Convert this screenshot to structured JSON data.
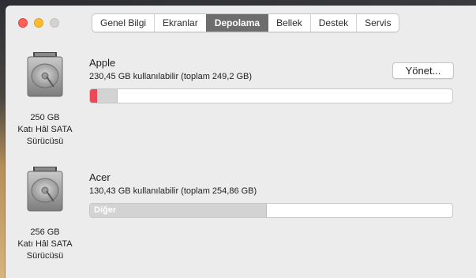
{
  "window": {
    "tabs": [
      {
        "label": "Genel Bilgi",
        "active": false
      },
      {
        "label": "Ekranlar",
        "active": false
      },
      {
        "label": "Depolama",
        "active": true
      },
      {
        "label": "Bellek",
        "active": false
      },
      {
        "label": "Destek",
        "active": false
      },
      {
        "label": "Servis",
        "active": false
      }
    ]
  },
  "colors": {
    "used_segment": "#ec4957",
    "other_segment": "#d3d3d3",
    "active_tab": "#6d6d6d"
  },
  "disks": [
    {
      "name": "Apple",
      "available": "230,45 GB kullanılabilir (toplam 249,2 GB)",
      "caption_size": "250 GB",
      "caption_type": "Katı Hâl SATA",
      "caption_kind": "Sürücüsü",
      "manage_label": "Yönet...",
      "icon": "hard-drive-icon",
      "usage_fraction": 0.076,
      "used_fraction": 0.02
    },
    {
      "name": "Acer",
      "available": "130,43 GB kullanılabilir (toplam 254,86 GB)",
      "caption_size": "256 GB",
      "caption_type": "Katı Hâl SATA",
      "caption_kind": "Sürücüsü",
      "other_label": "Diğer",
      "icon": "hard-drive-icon",
      "usage_fraction": 0.488
    }
  ]
}
